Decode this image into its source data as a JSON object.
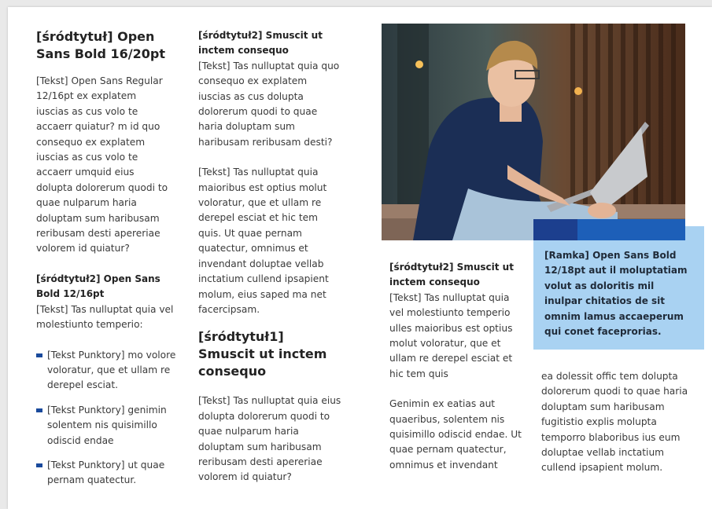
{
  "col1": {
    "heading": "[śródtytuł] Open Sans Bold 16/20pt",
    "body": "[Tekst] Open Sans Regular 12/16pt ex explatem iuscias as cus volo te accaerr quiatur? m id quo consequo ex explatem iuscias as cus volo te accaerr umquid eius dolupta dolorerum quodi to quae nulparum haria doluptam sum haribusam reribusam desti apereriae volorem id quiatur?",
    "sub_heading": "[śródtytuł2] Open Sans Bold 12/16pt",
    "sub_body": "[Tekst] Tas nulluptat quia vel molestiunto temperio:",
    "bullets": [
      "[Tekst Punktory] mo volore voloratur, que et ullam re derepel esciat.",
      "[Tekst Punktory] genimin solentem nis quisimillo odiscid endae",
      "[Tekst Punktory] ut quae pernam quatectur."
    ]
  },
  "col2": {
    "sub_heading": "[śródtytuł2] Smuscit ut inctem consequo",
    "para1": "[Tekst] Tas nulluptat quia quo consequo ex explatem iuscias as cus dolupta dolorerum quodi to quae haria doluptam sum haribusam reribusam desti?",
    "para2": "[Tekst] Tas nulluptat quia maioribus est optius molut voloratur, que et ullam re derepel esciat et hic tem quis. Ut quae pernam quatectur, omnimus et invendant doluptae vellab inctatium cullend ipsapient molum, eius saped ma net facercipsam.",
    "heading": "[śródtytuł1] Smuscit ut inctem consequo",
    "para3": "[Tekst] Tas nulluptat quia eius dolupta dolorerum quodi to quae nulparum haria doluptam sum haribusam reribusam desti apereriae volorem id quiatur?"
  },
  "col3": {
    "sub_heading": "[śródtytuł2] Smuscit ut inctem consequo",
    "para1": "[Tekst] Tas nulluptat quia vel molestiunto temperio ulles maioribus est optius molut voloratur, que et ullam re derepel esciat et hic tem quis",
    "para2": "Genimin ex eatias aut quaeribus, solentem nis quisimillo odiscid endae. Ut quae pernam quatectur, omnimus et invendant"
  },
  "ramka": {
    "text": "[Ramka] Open Sans Bold 12/18pt aut il moluptatiam volut as doloritis mil inulpar chitatios de sit omnim lamus accaeperum qui conet faceprorias."
  },
  "col4": {
    "para": "ea dolessit offic tem dolupta dolorerum quodi to quae haria doluptam sum haribusam fugitistio explis molupta temporro blaboribus ius eum doluptae vellab inctatium cullend ipsapient molum."
  },
  "colors": {
    "accent_dark": "#1c3f8e",
    "accent": "#1d5fb8",
    "box": "#a9d2f2",
    "bullet": "#1a4a9c"
  }
}
